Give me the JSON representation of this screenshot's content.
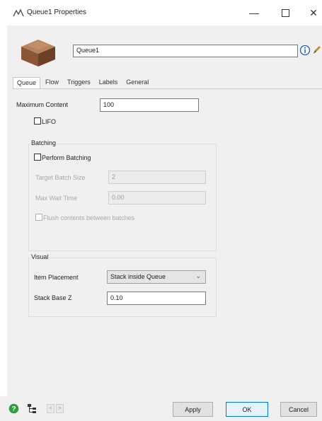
{
  "window": {
    "title": "Queue1 Properties",
    "minimize_glyph": "—",
    "close_glyph": "✕"
  },
  "object": {
    "name": "Queue1",
    "image_icon": "box-icon",
    "info_icon": "info-icon",
    "edit_icon": "pencil-icon"
  },
  "tabs": [
    {
      "label": "Queue",
      "active": true
    },
    {
      "label": "Flow",
      "active": false
    },
    {
      "label": "Triggers",
      "active": false
    },
    {
      "label": "Labels",
      "active": false
    },
    {
      "label": "General",
      "active": false
    }
  ],
  "queue": {
    "max_content_label": "Maximum Content",
    "max_content_value": "100",
    "lifo_label": "LIFO",
    "lifo_checked": false
  },
  "batching": {
    "group_label": "Batching",
    "perform_label": "Perform Batching",
    "perform_checked": false,
    "target_label": "Target Batch Size",
    "target_value": "2",
    "max_wait_label": "Max Wait Time",
    "max_wait_value": "0.00",
    "flush_label": "Flush contents between batches",
    "flush_checked": false
  },
  "visual": {
    "group_label": "Visual",
    "placement_label": "Item Placement",
    "placement_value": "Stack inside Queue",
    "stack_label": "Stack Base Z",
    "stack_value": "0.10"
  },
  "bottom": {
    "help_icon": "help-icon",
    "tree_icon": "tree-icon",
    "prev_label": "<",
    "next_label": ">",
    "apply_label": "Apply",
    "ok_label": "OK",
    "cancel_label": "Cancel"
  },
  "colors": {
    "panel": "#f0f0f0",
    "accent": "#0078d7",
    "help_green": "#2e9e3e"
  }
}
